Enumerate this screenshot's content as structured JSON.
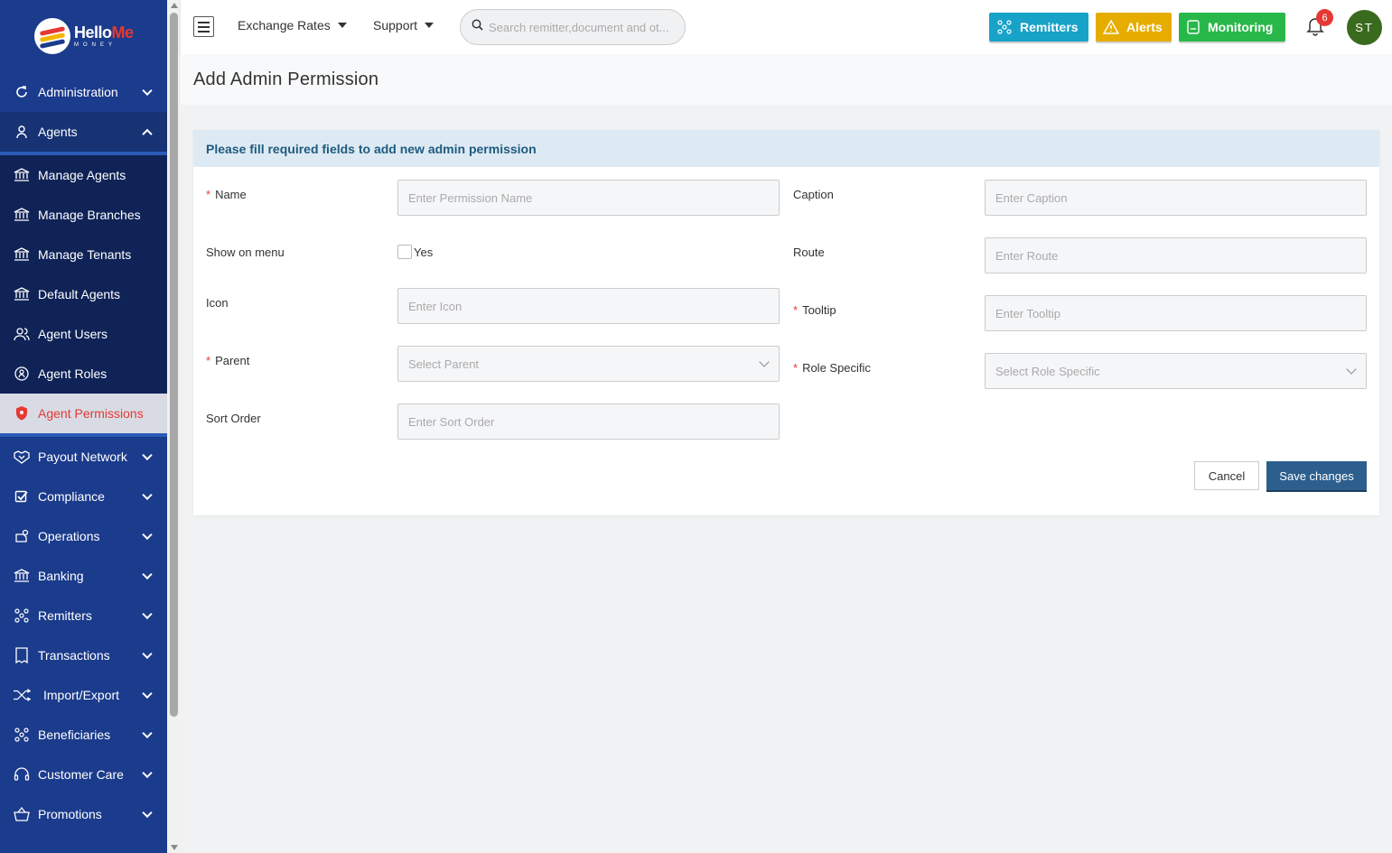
{
  "brand": {
    "logo_main": "Hello",
    "logo_accent": "Me",
    "logo_sub": "MONEY"
  },
  "sidebar": {
    "items_top": [
      {
        "label": "Administration",
        "icon": "refresh-icon"
      },
      {
        "label": "Agents",
        "icon": "user-icon"
      }
    ],
    "agents_submenu": [
      {
        "label": "Manage Agents",
        "icon": "bank-icon"
      },
      {
        "label": "Manage Branches",
        "icon": "bank-icon"
      },
      {
        "label": "Manage Tenants",
        "icon": "bank-icon"
      },
      {
        "label": "Default Agents",
        "icon": "bank-icon"
      },
      {
        "label": "Agent Users",
        "icon": "users-icon"
      },
      {
        "label": "Agent Roles",
        "icon": "badge-icon"
      },
      {
        "label": "Agent Permissions",
        "icon": "shield-icon",
        "active": true
      }
    ],
    "items_bottom": [
      {
        "label": "Payout Network",
        "icon": "handshake-icon"
      },
      {
        "label": "Compliance",
        "icon": "check-icon"
      },
      {
        "label": "Operations",
        "icon": "operations-icon"
      },
      {
        "label": "Banking",
        "icon": "bank-icon"
      },
      {
        "label": "Remitters",
        "icon": "network-icon"
      },
      {
        "label": "Transactions",
        "icon": "receipt-icon"
      },
      {
        "label": "Import/Export",
        "icon": "shuffle-icon"
      },
      {
        "label": "Beneficiaries",
        "icon": "network-icon"
      },
      {
        "label": "Customer Care",
        "icon": "headset-icon"
      },
      {
        "label": "Promotions",
        "icon": "basket-icon"
      }
    ]
  },
  "topbar": {
    "exchange_rates": "Exchange Rates",
    "support": "Support",
    "search_placeholder": "Search remitter,document and ot...",
    "remitters_btn": "Remitters",
    "alerts_btn": "Alerts",
    "monitoring_btn": "Monitoring",
    "notification_count": "6",
    "avatar_initials": "ST",
    "colors": {
      "remitters": "#17a2c8",
      "alerts": "#e6ad00",
      "monitoring": "#28b84a"
    }
  },
  "page": {
    "title": "Add Admin Permission"
  },
  "form": {
    "header": "Please fill required fields to add new admin permission",
    "name_label": "Name",
    "name_placeholder": "Enter Permission Name",
    "caption_label": "Caption",
    "caption_placeholder": "Enter Caption",
    "show_on_menu_label": "Show on menu",
    "show_on_menu_option": "Yes",
    "route_label": "Route",
    "route_placeholder": "Enter Route",
    "icon_label": "Icon",
    "icon_placeholder": "Enter Icon",
    "tooltip_label": "Tooltip",
    "tooltip_placeholder": "Enter Tooltip",
    "parent_label": "Parent",
    "parent_placeholder": "Select Parent",
    "role_specific_label": "Role Specific",
    "role_specific_placeholder": "Select Role Specific",
    "sort_order_label": "Sort Order",
    "sort_order_placeholder": "Enter Sort Order",
    "required_mark": "*",
    "cancel": "Cancel",
    "save": "Save changes"
  }
}
